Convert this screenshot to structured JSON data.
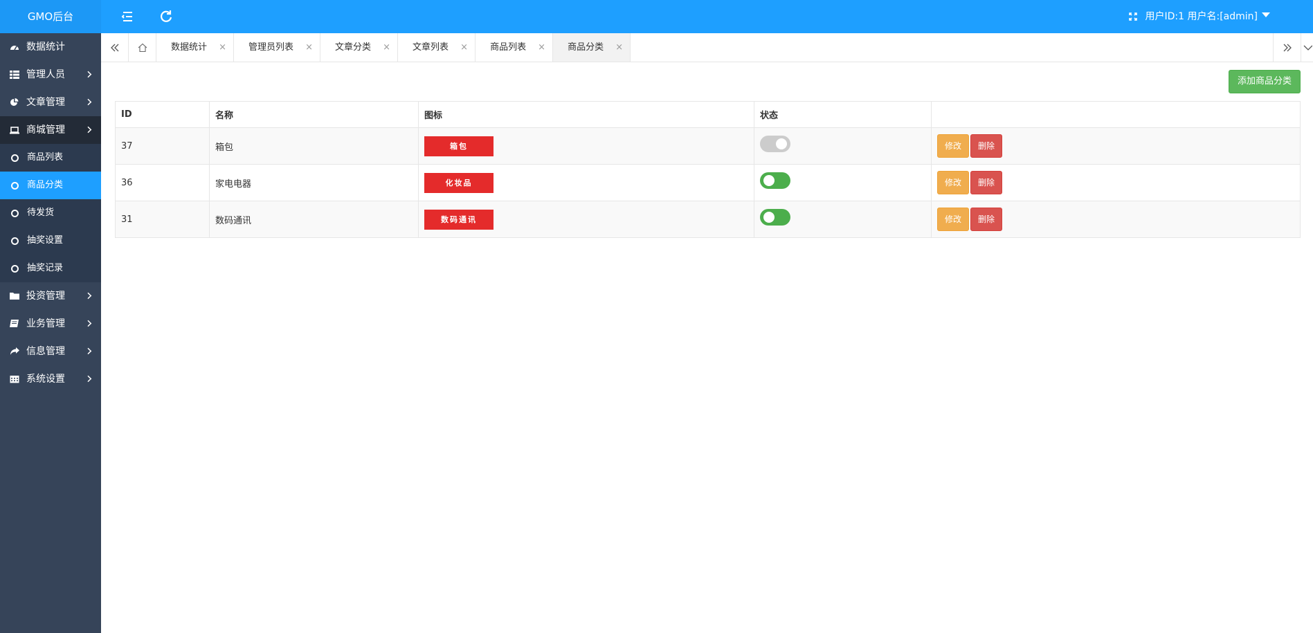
{
  "header": {
    "brand": "GMO后台",
    "user_info": "用户ID:1 用户名:[admin]"
  },
  "sidebar": {
    "items": [
      {
        "label": "数据统计",
        "icon": "dashboard-icon"
      },
      {
        "label": "管理人员",
        "icon": "grid-icon"
      },
      {
        "label": "文章管理",
        "icon": "pie-chart-icon"
      },
      {
        "label": "商城管理",
        "icon": "laptop-icon"
      },
      {
        "label": "投资管理",
        "icon": "folder-icon"
      },
      {
        "label": "业务管理",
        "icon": "book-icon"
      },
      {
        "label": "信息管理",
        "icon": "share-icon"
      },
      {
        "label": "系统设置",
        "icon": "calendar-icon"
      }
    ],
    "sub_items": [
      {
        "label": "商品列表"
      },
      {
        "label": "商品分类"
      },
      {
        "label": "待发货"
      },
      {
        "label": "抽奖设置"
      },
      {
        "label": "抽奖记录"
      }
    ]
  },
  "tabs": [
    {
      "label": "数据统计"
    },
    {
      "label": "管理员列表"
    },
    {
      "label": "文章分类"
    },
    {
      "label": "文章列表"
    },
    {
      "label": "商品列表"
    },
    {
      "label": "商品分类"
    }
  ],
  "toolbar": {
    "add_label": "添加商品分类"
  },
  "table": {
    "headers": [
      "ID",
      "名称",
      "图标",
      "状态",
      ""
    ],
    "rows": [
      {
        "id": "37",
        "name": "箱包",
        "icon_text": "箱包",
        "status": false,
        "edit": "修改",
        "delete": "删除"
      },
      {
        "id": "36",
        "name": "家电电器",
        "icon_text": "化妆品",
        "status": true,
        "edit": "修改",
        "delete": "删除"
      },
      {
        "id": "31",
        "name": "数码通讯",
        "icon_text": "数码通讯",
        "status": true,
        "edit": "修改",
        "delete": "删除"
      }
    ]
  },
  "colors": {
    "header": "#1e9fff",
    "sidebar": "#364459",
    "active": "#1e9fff",
    "add_button": "#5cb85c",
    "edit_button": "#f0ad4e",
    "delete_button": "#d9534f",
    "icon_bg": "#e42b2b"
  }
}
